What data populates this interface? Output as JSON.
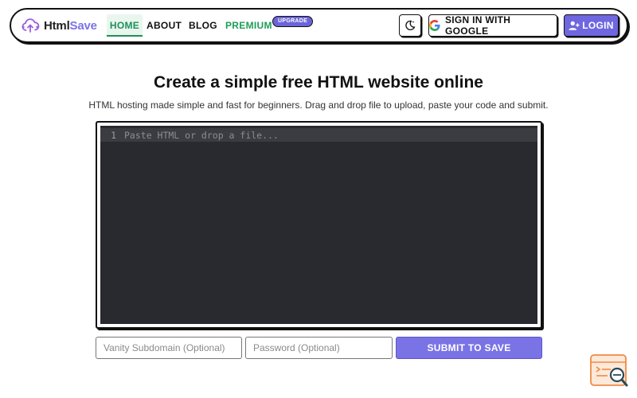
{
  "brand": {
    "name_part1": "Html",
    "name_part2": "Save",
    "logo_icon": "cloud-upload-icon"
  },
  "nav": {
    "home": "HOME",
    "about": "ABOUT",
    "blog": "BLOG",
    "premium": "PREMIUM",
    "upgrade_badge": "UPGRADE"
  },
  "actions": {
    "theme_icon": "moon-icon",
    "google_signin": "SIGN IN WITH GOOGLE",
    "login": "LOGIN"
  },
  "hero": {
    "title": "Create a simple free HTML website online",
    "subtitle": "HTML hosting made simple and fast for beginners. Drag and drop file to upload, paste your code and submit."
  },
  "editor": {
    "line_number": "1",
    "placeholder": "Paste HTML or drop a file..."
  },
  "form": {
    "vanity_placeholder": "Vanity Subdomain (Optional)",
    "password_placeholder": "Password (Optional)",
    "submit_label": "SUBMIT TO SAVE"
  },
  "colors": {
    "accent": "#7a73e6",
    "premium_green": "#1f9d57",
    "editor_bg": "#282a2f"
  }
}
